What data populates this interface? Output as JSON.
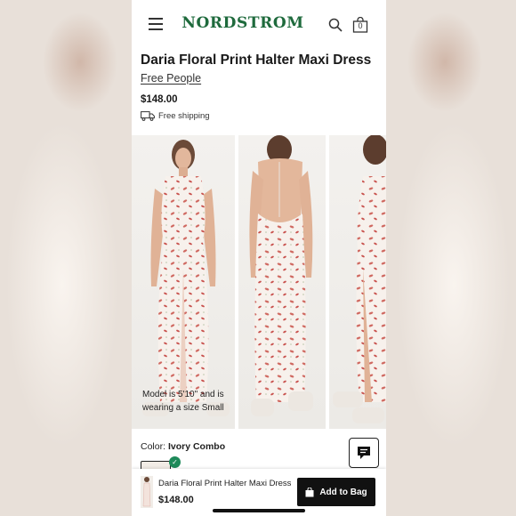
{
  "header": {
    "logo": "NORDSTROM",
    "bag_count": "0",
    "icons": [
      "hamburger-menu-icon",
      "search-icon",
      "shopping-bag-icon"
    ]
  },
  "product": {
    "title": "Daria Floral Print Halter Maxi Dress",
    "brand": "Free People",
    "price": "$148.00",
    "shipping": "Free shipping",
    "model_note": "Model is 5'10\" and is wearing a size Small",
    "color_label": "Color:",
    "color_value": "Ivory Combo"
  },
  "sticky_bar": {
    "name": "Daria Floral Print Halter Maxi Dress",
    "price": "$148.00",
    "button_label": "Add to Bag"
  },
  "colors": {
    "brand_green": "#1e6a3c",
    "check_green": "#1e8a5a",
    "button_black": "#111111",
    "print_red": "#c94a4a"
  }
}
